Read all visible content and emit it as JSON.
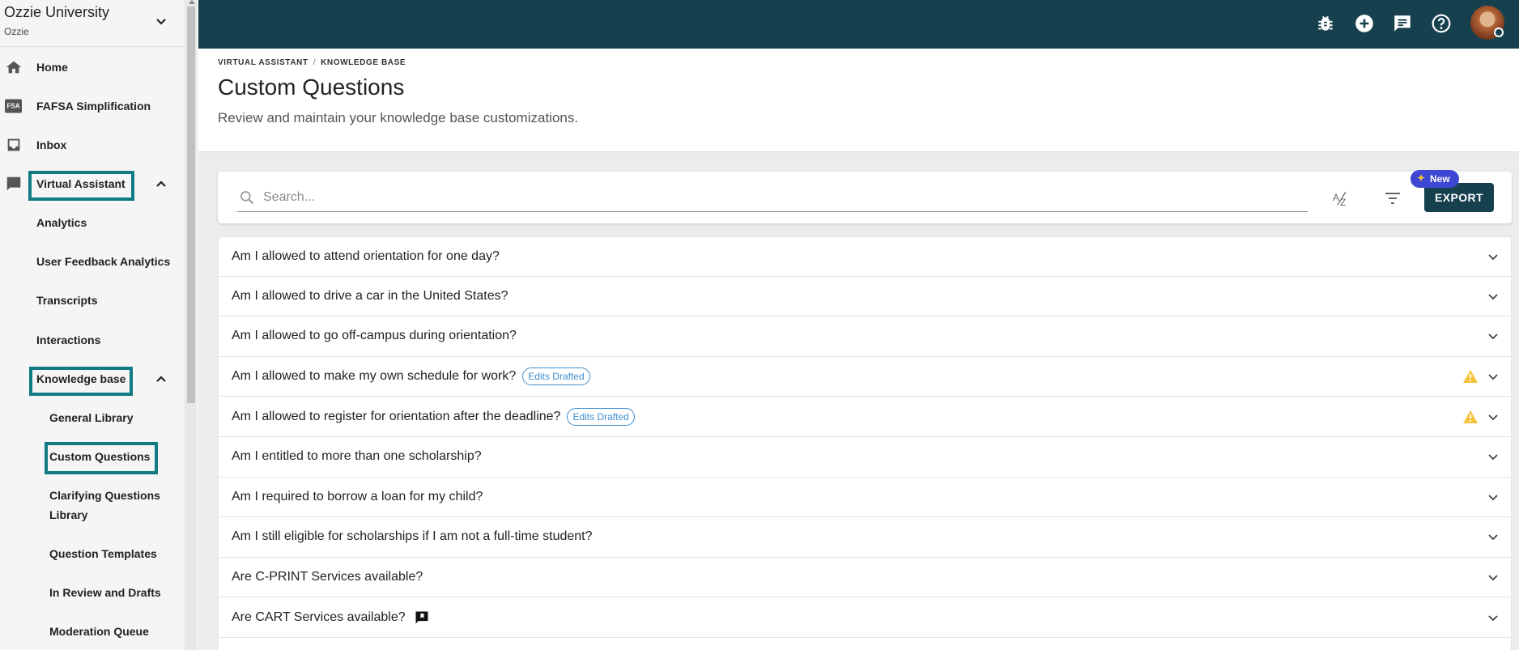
{
  "org": {
    "name": "Ozzie University",
    "sub": "Ozzie"
  },
  "sidebar": {
    "items": [
      {
        "label": "Home",
        "icon": "home-icon"
      },
      {
        "label": "FAFSA Simplification",
        "icon": "fsa-icon",
        "icon_text": "FSA"
      },
      {
        "label": "Inbox",
        "icon": "inbox-icon"
      },
      {
        "label": "Virtual Assistant",
        "icon": "chat-icon"
      }
    ],
    "va_children": [
      "Analytics",
      "User Feedback Analytics",
      "Transcripts",
      "Interactions",
      "Knowledge base"
    ],
    "kb_children": [
      "General Library",
      "Custom Questions",
      "Clarifying Questions",
      "Library",
      "Question Templates",
      "In Review and Drafts",
      "Moderation Queue"
    ]
  },
  "topbar": {
    "icons": [
      "bug-icon",
      "add-circle-icon",
      "feedback-icon",
      "help-icon",
      "user-avatar"
    ],
    "accent": "#17404f"
  },
  "breadcrumb": {
    "parent": "VIRTUAL ASSISTANT",
    "separator": "/",
    "current": "KNOWLEDGE BASE"
  },
  "page": {
    "title": "Custom Questions",
    "subtitle": "Review and maintain your knowledge base customizations."
  },
  "search": {
    "placeholder": "Search...",
    "value": ""
  },
  "toolbar": {
    "export_label": "EXPORT",
    "new_badge": "New"
  },
  "questions": [
    {
      "text": "Am I allowed to attend orientation for one day?"
    },
    {
      "text": "Am I allowed to drive a car in the United States?"
    },
    {
      "text": "Am I allowed to go off-campus during orientation?"
    },
    {
      "text": "Am I allowed to make my own schedule for work?",
      "badge": "Edits Drafted",
      "warning": true
    },
    {
      "text": "Am I allowed to register for orientation after the deadline?",
      "badge": "Edits Drafted",
      "warning": true
    },
    {
      "text": "Am I entitled to more than one scholarship?"
    },
    {
      "text": "Am I required to borrow a loan for my child?"
    },
    {
      "text": "Am I still eligible for scholarships if I am not a full-time student?"
    },
    {
      "text": "Are C-PRINT Services available?"
    },
    {
      "text": "Are CART Services available?",
      "note_icon": true
    },
    {
      "text": ""
    }
  ],
  "colors": {
    "accent": "#17404f",
    "highlight": "#107b82",
    "draft": "#3d8fd1",
    "warning": "#f5c33b",
    "new_badge": "#3d47d3"
  }
}
